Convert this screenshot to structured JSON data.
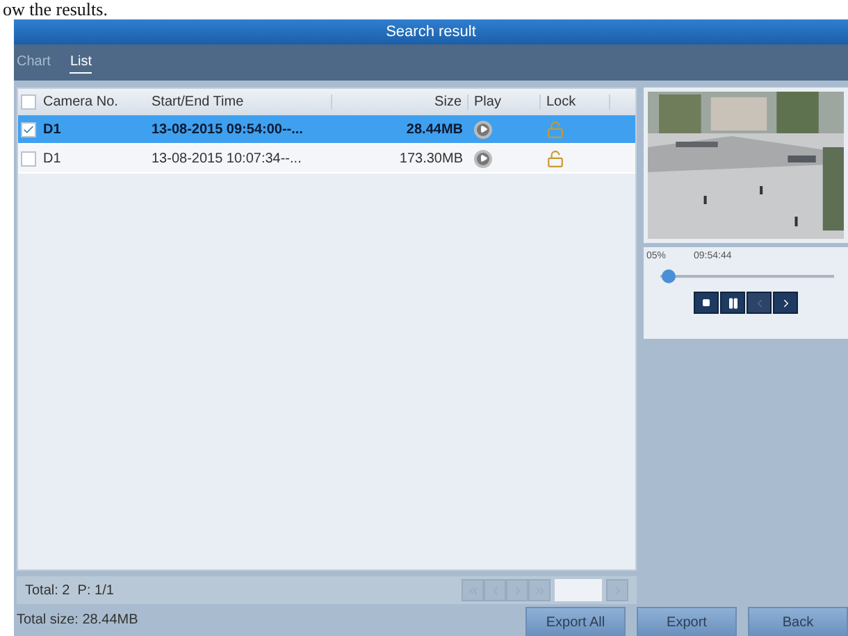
{
  "document_text": "ow the results.",
  "window": {
    "title": "Search result"
  },
  "tabs": [
    {
      "label": "Chart",
      "selected": false
    },
    {
      "label": "List",
      "selected": true
    }
  ],
  "table": {
    "select_all_checked": false,
    "columns": [
      "Camera No.",
      "Start/End Time",
      "Size",
      "Play",
      "Lock"
    ],
    "rows": [
      {
        "camera": "D1",
        "time": "13-08-2015 09:54:00--...",
        "size": "28.44MB",
        "checked": true,
        "selected": true
      },
      {
        "camera": "D1",
        "time": "13-08-2015 10:07:34--...",
        "size": "173.30MB",
        "checked": false,
        "selected": false
      }
    ]
  },
  "pager": {
    "summary": "Total: 2  P: 1/1"
  },
  "player": {
    "percent": "05%",
    "time": "09:54:44",
    "level": 0.05,
    "controls": [
      {
        "kind": "stop",
        "disabled": false
      },
      {
        "kind": "pause",
        "disabled": false
      },
      {
        "kind": "prev",
        "disabled": true
      },
      {
        "kind": "next",
        "disabled": false
      }
    ]
  },
  "footer": {
    "total_size": "Total size: 28.44MB",
    "buttons": [
      "Export All",
      "Export",
      "Back"
    ]
  }
}
